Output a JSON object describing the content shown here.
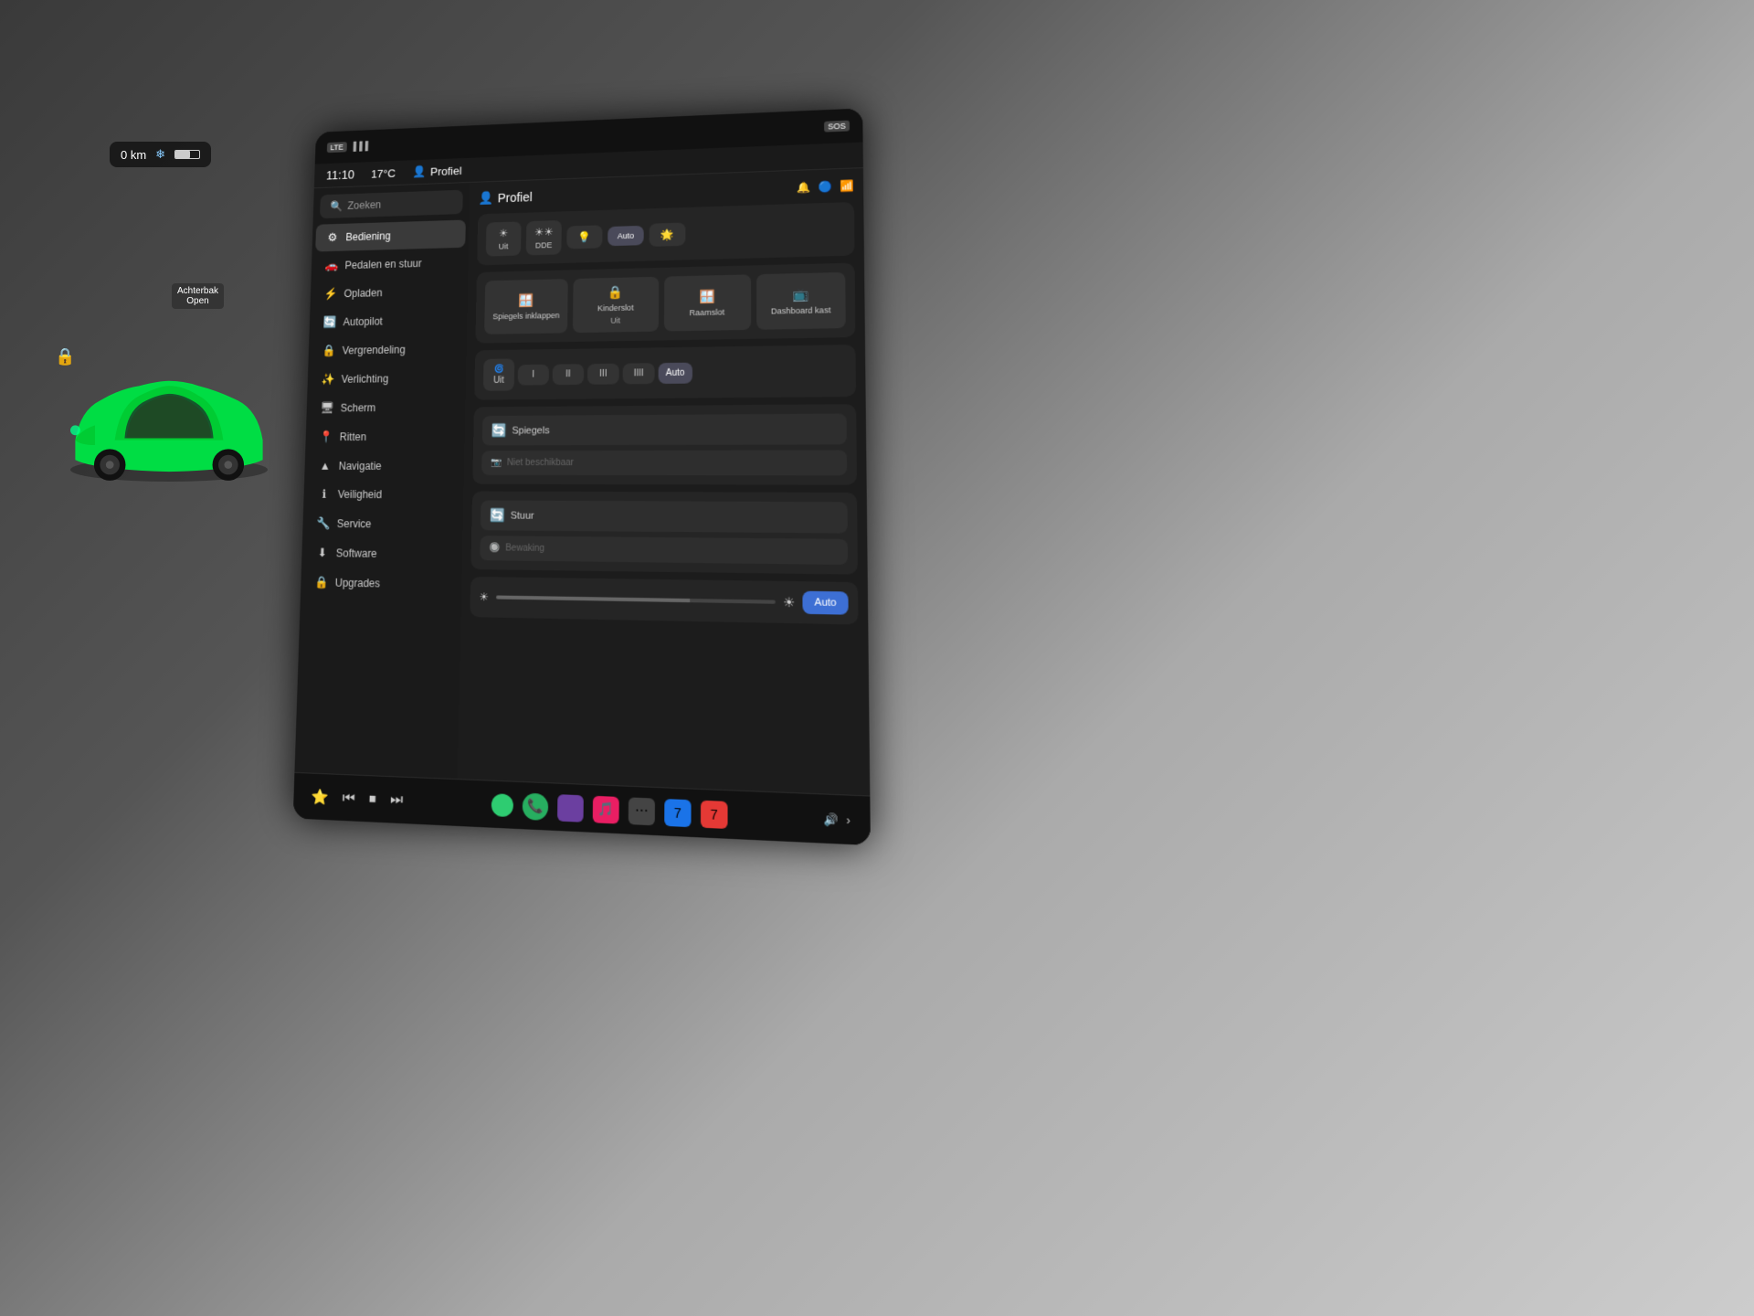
{
  "background": {
    "color": "#3a3a3a"
  },
  "status_bar": {
    "speed": "0 km",
    "snowflake": "❄",
    "lte_badge": "LTE",
    "sos_badge": "SOS"
  },
  "nav_bar": {
    "time": "11:10",
    "temp": "17°C",
    "profile_icon": "👤",
    "profile_label": "Profiel"
  },
  "search": {
    "placeholder": "Zoeken",
    "icon": "🔍"
  },
  "sidebar": {
    "items": [
      {
        "label": "Bediening",
        "icon": "⚙",
        "active": true
      },
      {
        "label": "Pedalen en stuur",
        "icon": "🚗",
        "active": false
      },
      {
        "label": "Opladen",
        "icon": "⚡",
        "active": false
      },
      {
        "label": "Autopilot",
        "icon": "🔄",
        "active": false
      },
      {
        "label": "Vergrendeling",
        "icon": "🔒",
        "active": false
      },
      {
        "label": "Verlichting",
        "icon": "💡",
        "active": false
      },
      {
        "label": "Scherm",
        "icon": "🖥",
        "active": false
      },
      {
        "label": "Ritten",
        "icon": "📍",
        "active": false
      },
      {
        "label": "Navigatie",
        "icon": "▲",
        "active": false
      },
      {
        "label": "Veiligheid",
        "icon": "ℹ",
        "active": false
      },
      {
        "label": "Service",
        "icon": "🔧",
        "active": false
      },
      {
        "label": "Software",
        "icon": "⬇",
        "active": false
      },
      {
        "label": "Upgrades",
        "icon": "🔒",
        "active": false
      }
    ]
  },
  "panel": {
    "title": "Profiel",
    "title_icon": "👤",
    "icons": [
      "🔔",
      "🔵",
      "📶"
    ]
  },
  "lights": {
    "buttons": [
      {
        "label": "Uit",
        "icon": "☀",
        "active": false
      },
      {
        "label": "DDE",
        "icon": "☀☀",
        "active": false
      },
      {
        "label": "",
        "icon": "💡",
        "active": false
      },
      {
        "label": "Auto",
        "icon": "",
        "active": true
      },
      {
        "label": "",
        "icon": "🌟",
        "active": false
      }
    ]
  },
  "quick_controls": {
    "buttons": [
      {
        "label": "Spiegels inklappen",
        "icon": "🪟"
      },
      {
        "label": "Kinderslot\nUit",
        "icon": "🔒"
      },
      {
        "label": "Raamslot",
        "icon": "🪟"
      },
      {
        "label": "Dashboard kast",
        "icon": "📺"
      }
    ]
  },
  "wipers": {
    "buttons": [
      {
        "label": "Uit",
        "icon": "🌀",
        "active": false
      },
      {
        "label": "I",
        "active": false
      },
      {
        "label": "II",
        "active": false
      },
      {
        "label": "III",
        "active": false
      },
      {
        "label": "IIII",
        "active": false
      },
      {
        "label": "Auto",
        "active": true
      }
    ]
  },
  "mirrors_section": {
    "mirror_label": "Spiegels",
    "steer_label": "Stuur",
    "camera_label": "Niet beschikbaar",
    "security_label": "Bewaking"
  },
  "brightness": {
    "value": 70,
    "auto_label": "Auto"
  },
  "car_status": {
    "speed": "0 km",
    "trunk_line1": "Achterbak",
    "trunk_line2": "Open"
  },
  "taskbar": {
    "media_icons": [
      "⭐",
      "⏮",
      "⏹",
      "⏭"
    ],
    "apps": [
      {
        "type": "green-dot",
        "label": ""
      },
      {
        "type": "phone",
        "label": "📞"
      },
      {
        "type": "purple",
        "label": "🟣"
      },
      {
        "type": "pink",
        "label": "🎵"
      },
      {
        "type": "dots",
        "label": "⋯"
      },
      {
        "type": "blue-bt",
        "label": "🔵"
      },
      {
        "type": "red",
        "label": "7"
      }
    ],
    "right_icons": [
      "🔊",
      "›"
    ]
  }
}
